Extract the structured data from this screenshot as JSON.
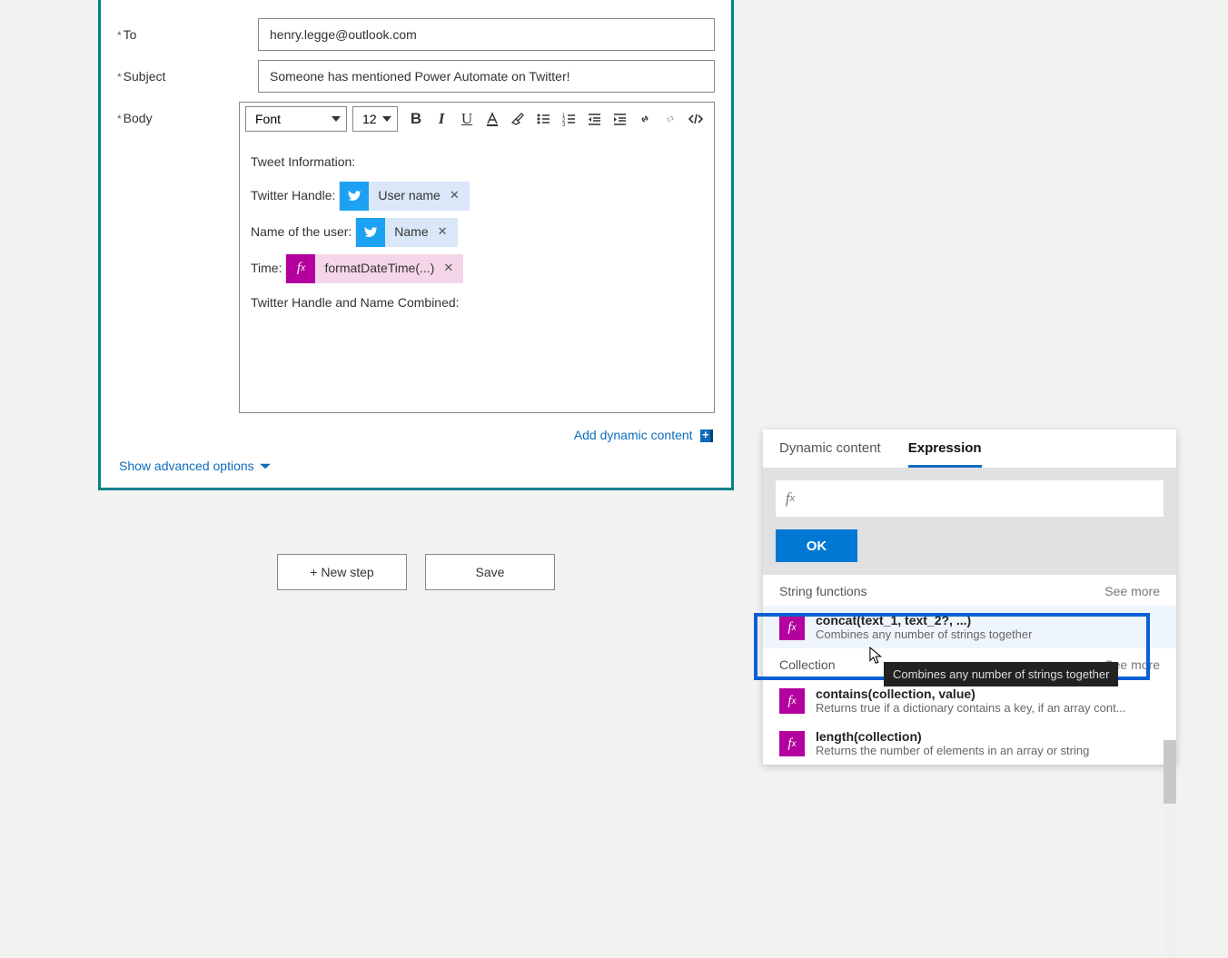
{
  "fields": {
    "to_label": "To",
    "to_value": "henry.legge@outlook.com",
    "subject_label": "Subject",
    "subject_value": "Someone has mentioned Power Automate on Twitter!",
    "body_label": "Body"
  },
  "toolbar": {
    "font": "Font",
    "size": "12"
  },
  "editor": {
    "line1": "Tweet Information:",
    "handle_label": "Twitter Handle:",
    "handle_token": "User name",
    "nameuser_label": "Name of the user:",
    "nameuser_token": "Name",
    "time_label": "Time:",
    "time_token": "formatDateTime(...)",
    "combined_label": "Twitter Handle and Name Combined:"
  },
  "links": {
    "add_dynamic": "Add dynamic content",
    "advanced": "Show advanced options"
  },
  "buttons": {
    "new_step": "+ New step",
    "save": "Save"
  },
  "panel": {
    "tab_dynamic": "Dynamic content",
    "tab_expression": "Expression",
    "ok": "OK",
    "sec_string": "String functions",
    "sec_collection": "Collection",
    "see_more": "See more",
    "concat_title": "concat(text_1, text_2?, ...)",
    "concat_desc": "Combines any number of strings together",
    "tooltip": "Combines any number of strings together",
    "contains_title": "contains(collection, value)",
    "contains_desc": "Returns true if a dictionary contains a key, if an array cont...",
    "length_title": "length(collection)",
    "length_desc": "Returns the number of elements in an array or string"
  }
}
